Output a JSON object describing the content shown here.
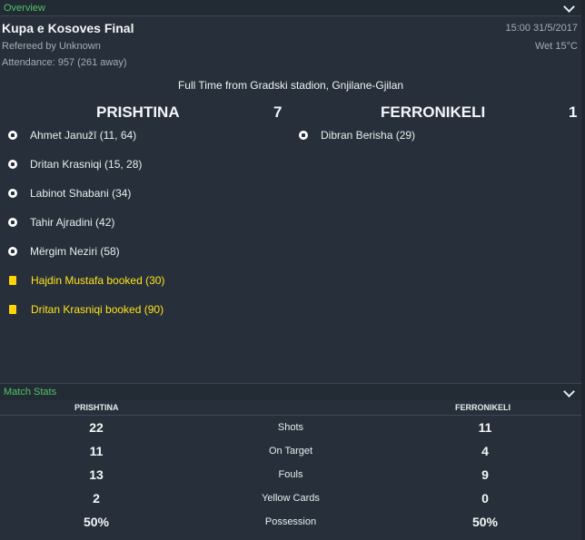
{
  "overview": {
    "section_label": "Overview",
    "title": "Kupa e Kosoves Final",
    "referee": "Refereed by Unknown",
    "attendance": "Attendance: 957 (261 away)",
    "datetime": "15:00 31/5/2017",
    "weather": "Wet 15°C",
    "full_time": "Full Time from Gradski stadion, Gnjilane-Gjilan"
  },
  "match": {
    "home": {
      "name": "PRISHTINA",
      "score": "7"
    },
    "away": {
      "name": "FERRONIKELI",
      "score": "1"
    },
    "home_events": [
      {
        "icon": "ball-icon",
        "text": "Ahmet Janužī (11, 64)"
      },
      {
        "icon": "ball-icon",
        "text": "Dritan Krasniqi (15, 28)"
      },
      {
        "icon": "ball-icon",
        "text": "Labinot Shabani (34)"
      },
      {
        "icon": "ball-icon",
        "text": "Tahir Ajradini (42)"
      },
      {
        "icon": "ball-icon",
        "text": "Mërgim Neziri (58)"
      },
      {
        "icon": "yellow-card-icon",
        "text": "Hajdin Mustafa booked (30)"
      },
      {
        "icon": "yellow-card-icon",
        "text": "Dritan Krasniqi booked (90)"
      }
    ],
    "away_events": [
      {
        "icon": "ball-icon",
        "text": "Dibran Berisha (29)"
      }
    ]
  },
  "match_stats": {
    "section_label": "Match Stats",
    "home_header": "PRISHTINA",
    "away_header": "FERRONIKELI",
    "rows": [
      {
        "label": "Shots",
        "home": "22",
        "away": "11"
      },
      {
        "label": "On Target",
        "home": "11",
        "away": "4"
      },
      {
        "label": "Fouls",
        "home": "13",
        "away": "9"
      },
      {
        "label": "Yellow Cards",
        "home": "2",
        "away": "0"
      },
      {
        "label": "Possession",
        "home": "50%",
        "away": "50%"
      }
    ]
  },
  "colors": {
    "background": "#27303a",
    "section_label": "#4fc36a",
    "booked_text": "#ffe21a"
  }
}
